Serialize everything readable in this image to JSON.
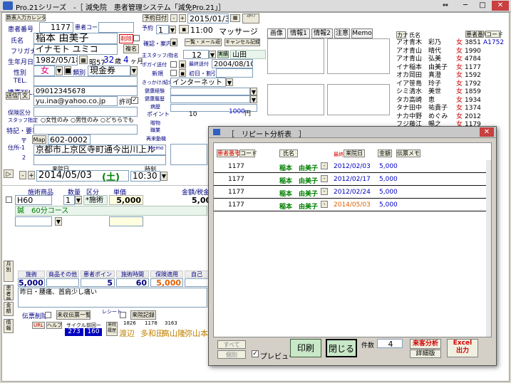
{
  "app": {
    "title": "Pro.21シリーズ　-［ 減免院　患者管理システム「減免Pro.21」］"
  },
  "patient": {
    "calendar_btn": "数表入力カレンダ",
    "id_label": "患者番号",
    "id_value": "1177",
    "code_label": "患者コード",
    "name_label": "氏名",
    "name_value": "稲本 由美子",
    "delete_label": "削除",
    "kana_label": "フリガナ",
    "kana_value": "イナモト ユミコ",
    "copy_btn": "複名",
    "birth_label": "生年月日",
    "birth_value": "1982/05/18",
    "era": "昭57",
    "age": "32",
    "age_unit": "歳",
    "months": "4",
    "months_unit": "ヶ月",
    "sex_label": "性別",
    "sex_value": "女",
    "type_label": "類別",
    "type_value": "現金券",
    "tel_label": "TEL.",
    "mobile_label": "携帯TEL.",
    "mobile_value": "09012345678",
    "mail_btn": "送信",
    "mail_btn2": "文",
    "email_value": "yu.ina@yahoo.co.jp",
    "permit_label": "許可",
    "insurance_label": "保険区分",
    "staff_label": "スタッフ指定",
    "staff_opts": [
      "女性のみ",
      "男性のみ",
      "どちらでも"
    ],
    "notes_label": "特記・要事",
    "zip_label": "〒",
    "map_btn": "Map",
    "zip_value": "602-0002",
    "addr_label": "住所-1",
    "addr_value": "京都市上京区寺町通今出川上ル",
    "addr2_label": "2"
  },
  "booking": {
    "booking_label": "予約日付",
    "date": "2015/01/31",
    "time": "11:00",
    "menu": "マッサージ",
    "week": "1",
    "confirm_label": "確認・案内",
    "list_btn": "一覧・メール返信",
    "cancel_btn": "キャンセル記録",
    "staff_label": "主スタッフ/指名",
    "staff_value": "12",
    "actual_label": "実績",
    "staff_name": "山田",
    "card_label": "ポガイ送付",
    "last_label": "最終送付",
    "last_date": "2004/08/10",
    "new_label": "新規",
    "first_label": "初日・割引",
    "intro_label": "きっかけ/紹介",
    "intro_value": "インターネット",
    "health_label": "健康経験",
    "health2_label": "健康履歴",
    "disease_label": "病歴",
    "point_label": "ポイント",
    "point_value": "10",
    "yen": "1000",
    "yen_unit": "円",
    "gift_label": "贈物",
    "job_label": "職業",
    "motive_label": "再来動機",
    "memo_label": "Memo"
  },
  "visit": {
    "visit_label": "来院日",
    "visit_date": "2014/05/03",
    "weekday": "(土)",
    "time_label": "時刻",
    "time": "10:30",
    "col_menu": "施術商品",
    "col_qty": "数量",
    "col_kubun": "区分",
    "col_price": "単価",
    "col_total": "金額/税金",
    "item_code": "H60",
    "item_qty": "1",
    "item_kubun": "*施術",
    "item_price": "5,000",
    "item_total": "5,000",
    "item_name": "鍼　60分コース",
    "sum_labels": [
      "施術",
      "商品その他",
      "患者ポイント",
      "施術時間",
      "保険適用",
      "自己"
    ],
    "sum_values": [
      "5,000",
      "",
      "5",
      "60",
      "5,000"
    ],
    "note": "昨日・腰痛、首肩少し痛い",
    "receipt_label": "伝票削除",
    "payment_btn": "未収伝票一覧",
    "receipt2_label": "レシート",
    "print_btn": "来院記録",
    "url_btn": "URL",
    "help_btn": "ヘルプ",
    "cycle_label": "サイクル",
    "prev_label": "前回ー",
    "cycle_val": "273",
    "prev_val": "160",
    "history_label": "来院履歴",
    "history_nums": [
      "1826",
      "1178",
      "3163"
    ],
    "history_names": [
      "渡辺",
      "多和田",
      "高山隆",
      "弥山本"
    ]
  },
  "side": {
    "monthly_btn": "月別",
    "history_btn": "患者検索",
    "graph_btn": "金額",
    "info_btn": "情報"
  },
  "tabs": [
    "画像",
    "情報1",
    "情報2",
    "注意",
    "Memo"
  ],
  "patient_list": {
    "col_kana": "カナ",
    "col_name": "氏名",
    "col_id_btn": "患者番号",
    "col_code_btn": "コード",
    "rows": [
      {
        "kana": "アオ",
        "name": "青木　彩乃",
        "sex": "女",
        "id": "3851",
        "code": "A1752"
      },
      {
        "kana": "アオ",
        "name": "青山　晴代",
        "sex": "女",
        "id": "1990",
        "code": ""
      },
      {
        "kana": "アオ",
        "name": "青山　弘美",
        "sex": "女",
        "id": "4784",
        "code": ""
      },
      {
        "kana": "イナ",
        "name": "稲本　由美子",
        "sex": "女",
        "id": "1177",
        "code": ""
      },
      {
        "kana": "オカ",
        "name": "岡田　真澄",
        "sex": "女",
        "id": "1592",
        "code": ""
      },
      {
        "kana": "イア",
        "name": "笹島　玲子",
        "sex": "女",
        "id": "1792",
        "code": ""
      },
      {
        "kana": "シミ",
        "name": "清水　美世",
        "sex": "女",
        "id": "1859",
        "code": ""
      },
      {
        "kana": "タカ",
        "name": "高崎　恵",
        "sex": "女",
        "id": "1934",
        "code": ""
      },
      {
        "kana": "タナ",
        "name": "田中　祐貴子",
        "sex": "女",
        "id": "1374",
        "code": ""
      },
      {
        "kana": "ナカ",
        "name": "中野　めぐみ",
        "sex": "女",
        "id": "2012",
        "code": ""
      },
      {
        "kana": "フジ",
        "name": "藤江　暢之",
        "sex": "女",
        "id": "1179",
        "code": ""
      }
    ]
  },
  "dialog": {
    "title": "［　リピート分析表　］",
    "col_id": "患者番号",
    "col_code": "コード",
    "col_name": "氏名",
    "col_last": "最終",
    "col_visit": "来院日",
    "col_amount": "金額",
    "col_memo": "伝票メモ",
    "rows": [
      {
        "id": "1177",
        "name": "稲本　由美子",
        "date": "2012/02/03",
        "amount": "5,000"
      },
      {
        "id": "1177",
        "name": "稲本　由美子",
        "date": "2012/02/17",
        "amount": "5,000"
      },
      {
        "id": "1177",
        "name": "稲本　由美子",
        "date": "2012/02/24",
        "amount": "5,000"
      },
      {
        "id": "1177",
        "name": "稲本　由美子",
        "date": "2014/05/03",
        "amount": "5,000"
      }
    ],
    "all_btn": "すべて",
    "each_btn": "個別",
    "preview_label": "プレビュー",
    "print_btn": "印刷",
    "close_btn": "閉じる",
    "count_label": "件数",
    "count_value": "4",
    "analysis_btn": "来客分析",
    "detail_btn": "詳細版",
    "excel_btn": "Excel\n出力"
  },
  "colors": {
    "accent": "#0000c0",
    "red": "#d00000",
    "green": "#008000",
    "orange": "#e06000"
  }
}
